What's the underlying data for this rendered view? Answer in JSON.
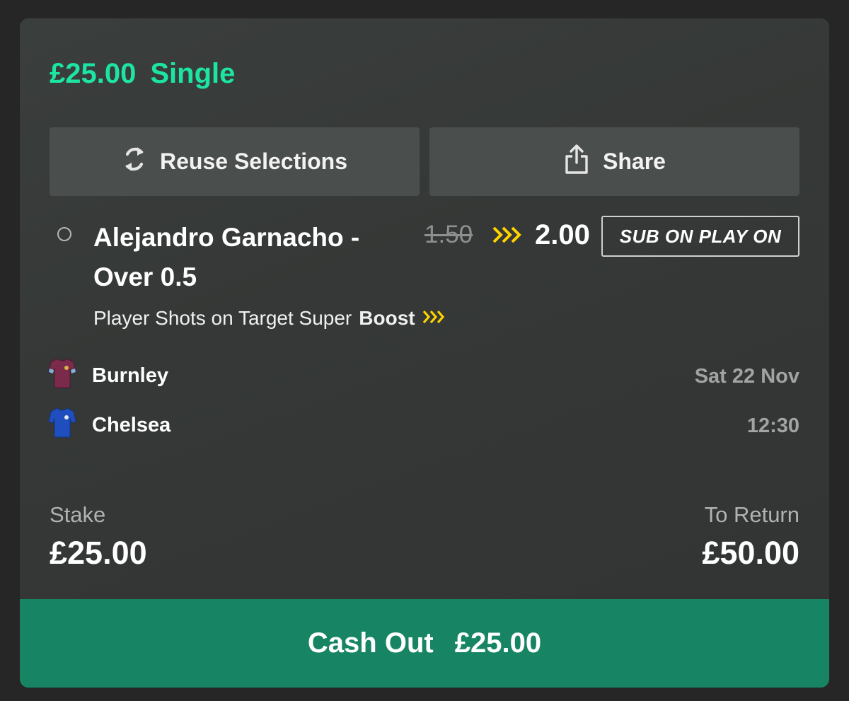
{
  "bet": {
    "stake_amount": "£25.00",
    "bet_type": "Single"
  },
  "actions": {
    "reuse_label": "Reuse Selections",
    "share_label": "Share",
    "reuse_icon": "refresh-icon",
    "share_icon": "share-icon"
  },
  "selection": {
    "name": "Alejandro Garnacho - Over 0.5",
    "old_odds": "1.50",
    "new_odds": "2.00",
    "badge": "SUB ON PLAY ON",
    "market": "Player Shots on Target Super",
    "market_boost": "Boost",
    "boost_color": "#ffd400"
  },
  "event": {
    "home_team": "Burnley",
    "away_team": "Chelsea",
    "home_kit_color": "#7a2a4a",
    "away_kit_color": "#1f4fbf",
    "date": "Sat 22 Nov",
    "time": "12:30"
  },
  "summary": {
    "stake_label": "Stake",
    "stake_value": "£25.00",
    "return_label": "To Return",
    "return_value": "£50.00"
  },
  "cashout": {
    "label": "Cash Out",
    "amount": "£25.00",
    "color": "#178563"
  },
  "colors": {
    "accent": "#1ce5a4",
    "card_bg": "#363937",
    "button_bg": "#4a4e4c"
  }
}
